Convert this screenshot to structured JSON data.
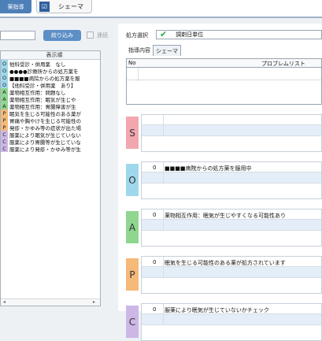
{
  "toolbar": {
    "left_button_label": "薬指導",
    "schema_button_label": "シェーマ"
  },
  "left": {
    "filter_button": "絞り込み",
    "continuous_label": "連続",
    "list_header": "表示順",
    "items": [
      {
        "tag": "O",
        "text": "他科受診・併用薬　なし",
        "color": "#9fd7ec"
      },
      {
        "tag": "O",
        "text": "●●●●診療所からの処方薬を",
        "color": "#9fd7ec"
      },
      {
        "tag": "O",
        "text": "■■■■病院からの処方薬を服",
        "color": "#9fd7ec"
      },
      {
        "tag": "O",
        "text": "【他科受診・併用薬　あり】",
        "color": "#9fd7ec"
      },
      {
        "tag": "A",
        "text": "薬物相互作用：問題なし",
        "color": "#8fd68f"
      },
      {
        "tag": "A",
        "text": "薬物相互作用：眠気が生じや",
        "color": "#8fd68f"
      },
      {
        "tag": "A",
        "text": "薬物相互作用：胃腸障害が生",
        "color": "#8fd68f"
      },
      {
        "tag": "P",
        "text": "眠気を生じる可能性のある薬が",
        "color": "#f5b978"
      },
      {
        "tag": "P",
        "text": "胃痛や胸やけを生じる可能性の",
        "color": "#f5b978"
      },
      {
        "tag": "P",
        "text": "発疹・かゆみ等の症状が出た場",
        "color": "#f5b978"
      },
      {
        "tag": "C",
        "text": "服薬により眠気が生じていない",
        "color": "#cdb7e6"
      },
      {
        "tag": "C",
        "text": "服薬により胃腸等が生じていな",
        "color": "#cdb7e6"
      },
      {
        "tag": "C",
        "text": "服薬により発疹・かゆみ等が生",
        "color": "#cdb7e6"
      }
    ]
  },
  "right": {
    "prescription_label": "処方選択",
    "prescription_value": "調剤日単位",
    "tabs": [
      "指導内容",
      "シェーマ"
    ],
    "table_no": "No",
    "table_problem": "プロブレムリスト",
    "soap": [
      {
        "letter": "S",
        "color": "#f2a7ae",
        "num": "",
        "text": ""
      },
      {
        "letter": "O",
        "color": "#9fd7ec",
        "num": "0",
        "text": "■■■■病院からの処方薬を服用中"
      },
      {
        "letter": "A",
        "color": "#8fd68f",
        "num": "0",
        "text": "薬物相互作用：眠気が生じやすくなる可能性あり"
      },
      {
        "letter": "P",
        "color": "#f5b978",
        "num": "0",
        "text": "眠気を生じる可能性のある薬が処方されています"
      },
      {
        "letter": "C",
        "color": "#cdb7e6",
        "num": "0",
        "text": "服薬により眠気が生じていないかチェック"
      }
    ]
  }
}
